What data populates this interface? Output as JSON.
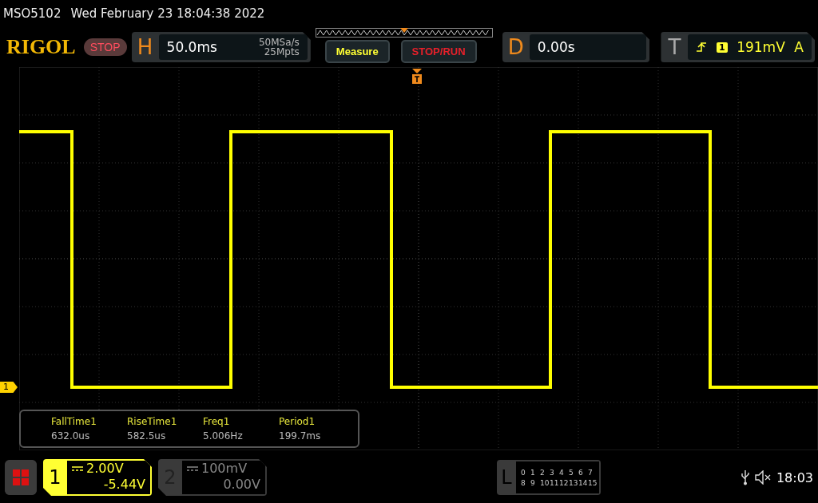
{
  "status_line": {
    "model": "MSO5102",
    "datetime": "Wed February 23 18:04:38 2022"
  },
  "header": {
    "logo": "RIGOL",
    "run_state": {
      "label": "STOP"
    },
    "horizontal": {
      "key": "H",
      "timebase": "50.0ms",
      "sample_rate": "50MSa/s",
      "memory_depth": "25Mpts"
    },
    "measure_button": "Measure",
    "stop_run_button": "STOP/RUN",
    "delay": {
      "key": "D",
      "value": "0.00s"
    },
    "trigger": {
      "key": "T",
      "source": "1",
      "level": "191mV",
      "mode": "A"
    }
  },
  "waveform": {
    "channel_marker": "1"
  },
  "measurements": [
    {
      "name": "FallTime1",
      "value": "632.0us"
    },
    {
      "name": "RiseTime1",
      "value": "582.5us"
    },
    {
      "name": "Freq1",
      "value": "5.006Hz"
    },
    {
      "name": "Period1",
      "value": "199.7ms"
    }
  ],
  "channels": [
    {
      "number": "1",
      "scale": "2.00V",
      "offset": "-5.44V",
      "active": true
    },
    {
      "number": "2",
      "scale": "100mV",
      "offset": "0.00V",
      "active": false
    }
  ],
  "logic": {
    "key": "L",
    "rows": [
      [
        "0",
        "1",
        "2",
        "3",
        "4",
        "5",
        "6",
        "7"
      ],
      [
        "8",
        "9",
        "10",
        "11",
        "12",
        "13",
        "14",
        "15"
      ]
    ]
  },
  "status_bar": {
    "time": "18:03"
  }
}
